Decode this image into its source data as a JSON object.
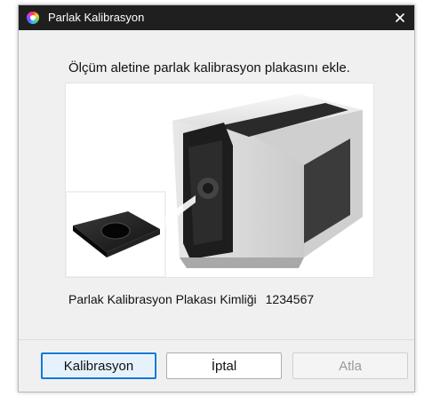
{
  "window": {
    "title": "Parlak Kalibrasyon",
    "app_icon": "color-wheel-icon",
    "close_icon": "close-icon"
  },
  "message": "Ölçüm aletine parlak kalibrasyon plakasını ekle.",
  "plate_id": {
    "label": "Parlak Kalibrasyon Plakası Kimliği",
    "value": "1234567"
  },
  "buttons": {
    "calibrate": "Kalibrasyon",
    "cancel": "İptal",
    "skip": "Atla"
  },
  "colors": {
    "titlebar": "#1f1f1f",
    "dialog_bg": "#f0f0f0",
    "focus_border": "#0078d7",
    "disabled_text": "#9a9a9a"
  }
}
